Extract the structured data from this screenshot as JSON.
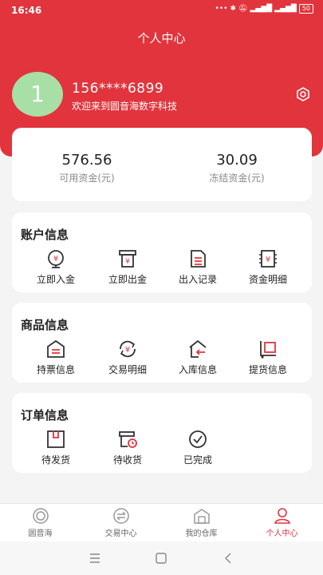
{
  "status": {
    "time": "16:46",
    "battery": "50"
  },
  "page": {
    "title": "个人中心"
  },
  "user": {
    "avatar_text": "1",
    "phone": "156****6899",
    "welcome": "欢迎来到圆音海数字科技"
  },
  "balance": {
    "available_value": "576.56",
    "available_label": "可用资金(元)",
    "frozen_value": "30.09",
    "frozen_label": "冻结资金(元)"
  },
  "account": {
    "title": "账户信息",
    "items": [
      {
        "label": "立即入金",
        "icon": "deposit-icon"
      },
      {
        "label": "立即出金",
        "icon": "withdraw-icon"
      },
      {
        "label": "出入记录",
        "icon": "record-icon"
      },
      {
        "label": "资金明细",
        "icon": "fund-detail-icon"
      }
    ]
  },
  "goods": {
    "title": "商品信息",
    "items": [
      {
        "label": "持票信息",
        "icon": "holding-icon"
      },
      {
        "label": "交易明细",
        "icon": "trade-detail-icon"
      },
      {
        "label": "入库信息",
        "icon": "warehouse-in-icon"
      },
      {
        "label": "提货信息",
        "icon": "pickup-icon"
      }
    ]
  },
  "orders": {
    "title": "订单信息",
    "items": [
      {
        "label": "待发货",
        "icon": "to-ship-icon"
      },
      {
        "label": "待收货",
        "icon": "to-receive-icon"
      },
      {
        "label": "已完成",
        "icon": "completed-icon"
      }
    ]
  },
  "tabs": [
    {
      "label": "圆音海",
      "icon": "home-icon"
    },
    {
      "label": "交易中心",
      "icon": "trade-center-icon"
    },
    {
      "label": "我的仓库",
      "icon": "my-warehouse-icon"
    },
    {
      "label": "个人中心",
      "icon": "profile-icon",
      "active": true
    }
  ],
  "colors": {
    "brand": "#e2343d",
    "avatar": "#a7dfa6",
    "background": "#f4f4f4"
  }
}
